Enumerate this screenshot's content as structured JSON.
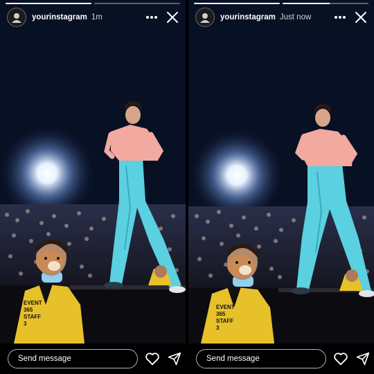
{
  "stories": [
    {
      "username": "yourinstagram",
      "time": "1m",
      "progress": [
        1.0,
        0.0
      ],
      "message_placeholder": "Send message",
      "shirt_text": "EVENT\n365\nSTAFF\n3"
    },
    {
      "username": "yourinstagram",
      "time": "Just now",
      "progress": [
        1.0,
        0.55
      ],
      "message_placeholder": "Send message",
      "shirt_text": "EVENT\n365\nSTAFF\n3"
    }
  ],
  "icons": {
    "more": "more-horizontal-icon",
    "close": "close-icon",
    "heart": "heart-icon",
    "send": "send-icon"
  },
  "colors": {
    "trousers": "#5bd0e0",
    "shirt": "#f2a9a0",
    "staff_jacket": "#e7c12a"
  }
}
